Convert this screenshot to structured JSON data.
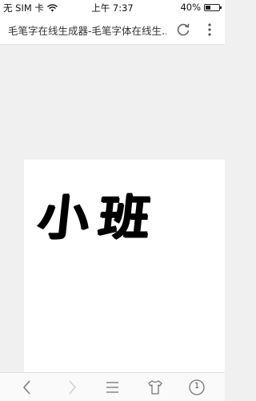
{
  "status_bar": {
    "carrier": "无 SIM 卡",
    "time": "上午 7:37",
    "battery_percent": "40%",
    "battery_level": 0.4
  },
  "browser": {
    "page_title": "毛笔字在线生成器-毛笔字体在线生..."
  },
  "result": {
    "text": "小班"
  },
  "toolbar": {
    "tab_count": "1"
  }
}
